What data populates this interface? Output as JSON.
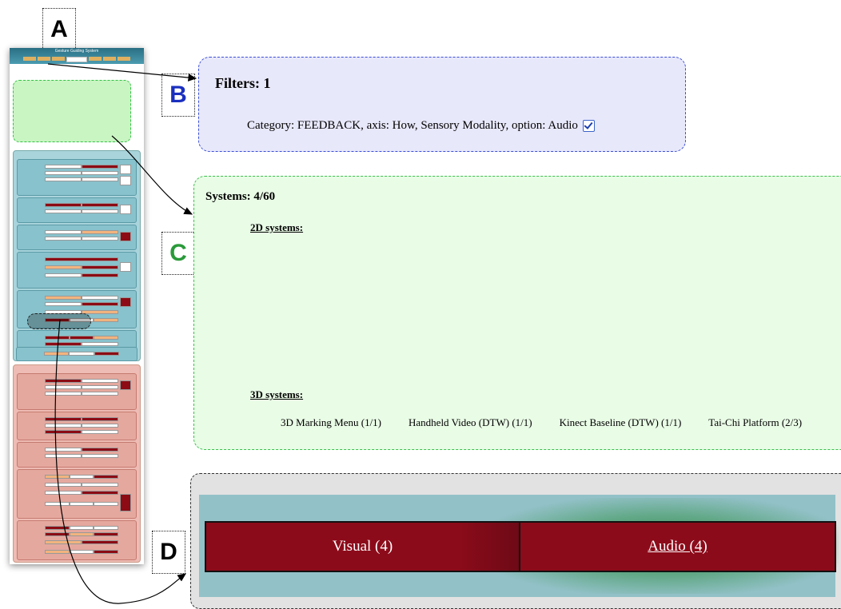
{
  "callouts": {
    "a": "A",
    "b": "B",
    "c": "C",
    "d": "D"
  },
  "filters": {
    "title": "Filters: 1",
    "filter_text": "Category: FEEDBACK, axis: How, Sensory Modality, option: Audio",
    "checked": true
  },
  "systems": {
    "title": "Systems: 4/60",
    "sections": [
      {
        "heading": "2D systems:",
        "items": []
      },
      {
        "heading": "3D systems:",
        "items": [
          "3D Marking Menu (1/1)",
          "Handheld Video (DTW) (1/1)",
          "Kinect Baseline (DTW) (1/1)",
          "Tai-Chi Platform (2/3)"
        ]
      }
    ]
  },
  "modality": {
    "cells": [
      {
        "label": "Visual (4)",
        "selected": false
      },
      {
        "label": "Audio (4)",
        "selected": true
      }
    ]
  },
  "thumbnail": {
    "title": "Gesture Guiding System"
  },
  "colors": {
    "filter_panel_border": "#3a4fd6",
    "systems_panel_border": "#37c24b",
    "cell_fill": "#8c0b1a",
    "teal_strip": "#93c1c8"
  }
}
